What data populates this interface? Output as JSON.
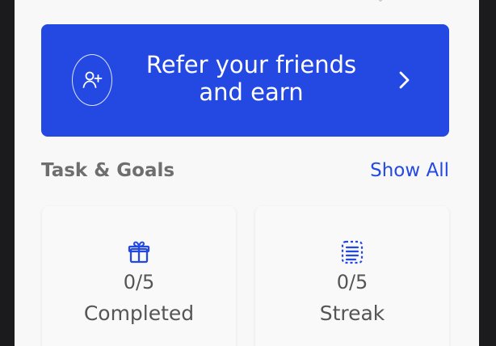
{
  "banner": {
    "title_line_1": "Refer your friends",
    "title_line_2": "and earn",
    "icon": "add-user-icon",
    "chevron_icon": "chevron-right-icon",
    "background_color": "#2449e2"
  },
  "tasks": {
    "heading": "Task & Goals",
    "show_all_label": "Show All",
    "cards": [
      {
        "icon": "gift-icon",
        "count": "0/5",
        "label": "Completed"
      },
      {
        "icon": "notes-icon",
        "count": "0/5",
        "label": "Streak"
      }
    ]
  },
  "colors": {
    "accent": "#2449e2",
    "page_background": "#f8f8f8",
    "text_muted": "#555555"
  }
}
